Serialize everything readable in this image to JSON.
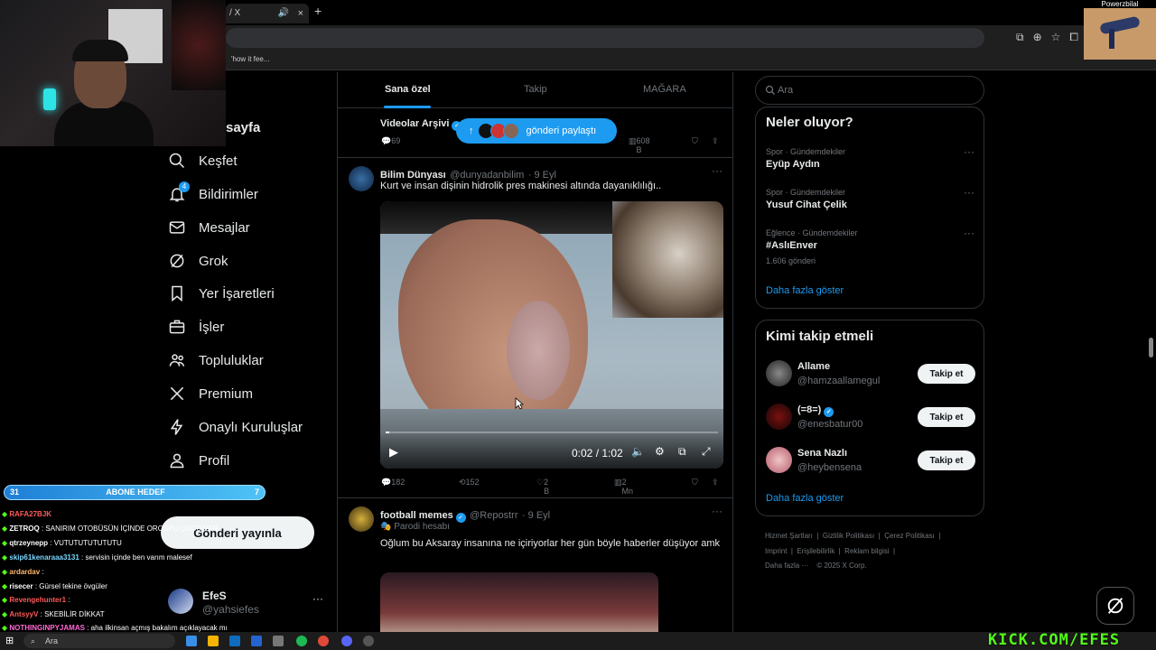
{
  "browser": {
    "tab_title": "/ X",
    "new_tab": "+",
    "tab_close": "×",
    "bookmark": "'how it fee..."
  },
  "stream": {
    "cam2_label": "Powerzbilal",
    "sub_goal": {
      "current": "31",
      "label": "ABONE HEDEF",
      "target": "7"
    },
    "chat": [
      {
        "user": "RAFA27BJK",
        "msg": "",
        "color": "#ff5a5a"
      },
      {
        "user": "ZETROQ",
        "msg": ": SANIRIM OTOBÜSÜN İÇİNDE OROSPU ÇOCU VAR",
        "color": "#ffffff"
      },
      {
        "user": "qtrzeynepp",
        "msg": ": VUTUTUTUTUTUTU",
        "color": "#ffffff"
      },
      {
        "user": "skip61kenaraaa3131",
        "msg": ": servisin içinde ben varım malesef",
        "color": "#7ad7ff"
      },
      {
        "user": "ardardav",
        "msg": ":",
        "color": "#ffb86c"
      },
      {
        "user": "risecer",
        "msg": ": Gürsel tekine övgüler",
        "color": "#ffffff"
      },
      {
        "user": "Revengehunter1",
        "msg": ":",
        "color": "#ff5a5a"
      },
      {
        "user": "AntsyyV",
        "msg": ": SKEBİLİR DİKKAT",
        "color": "#ff5a5a"
      },
      {
        "user": "NOTHINGINPYJAMAS",
        "msg": ": aha ilkinsan açmış bakalım açıklayacak mı",
        "color": "#ff6ad5"
      }
    ],
    "kick": "KICK.COM/EFES"
  },
  "nav": {
    "home_partial": "sayfa",
    "items": [
      {
        "label": "Keşfet",
        "icon": "search-icon"
      },
      {
        "label": "Bildirimler",
        "icon": "bell-icon",
        "badge": "4"
      },
      {
        "label": "Mesajlar",
        "icon": "mail-icon"
      },
      {
        "label": "Grok",
        "icon": "grok-icon"
      },
      {
        "label": "Yer İşaretleri",
        "icon": "bookmark-icon"
      },
      {
        "label": "İşler",
        "icon": "briefcase-icon"
      },
      {
        "label": "Topluluklar",
        "icon": "people-icon"
      },
      {
        "label": "Premium",
        "icon": "x-logo-icon"
      },
      {
        "label": "Onaylı Kuruluşlar",
        "icon": "lightning-icon"
      },
      {
        "label": "Profil",
        "icon": "person-icon"
      }
    ],
    "post_button": "Gönderi yayınla",
    "account": {
      "name": "EfeS",
      "handle": "@yahsiefes",
      "more": "···"
    }
  },
  "feed": {
    "tabs": [
      "Sana özel",
      "Takip",
      "MAĞARA"
    ],
    "share_pill": "gönderi paylaştı",
    "tweet0": {
      "name": "Videolar Arşivi",
      "replies": "69",
      "views": "608 B"
    },
    "tweet1": {
      "name": "Bilim Dünyası",
      "handle": "@dunyadanbilim",
      "date": "· 9 Eyl",
      "text": "Kurt ve insan dişinin hidrolik pres makinesi altında dayanıklılığı..",
      "video_time": "0:02 / 1:02",
      "replies": "182",
      "reposts": "152",
      "likes": "2 B",
      "views": "2 Mn"
    },
    "tweet2": {
      "name": "football memes",
      "handle": "@Repostrr",
      "date": "· 9 Eyl",
      "parody": "Parodi hesabı",
      "text": "Oğlum bu Aksaray insanına ne içiriyorlar her gün böyle haberler düşüyor amk"
    }
  },
  "sidebar": {
    "search_placeholder": "Ara",
    "trends_title": "Neler oluyor?",
    "trends": [
      {
        "category": "Spor · Gündemdekiler",
        "name": "Eyüp Aydın",
        "count": ""
      },
      {
        "category": "Spor · Gündemdekiler",
        "name": "Yusuf Cihat Çelik",
        "count": ""
      },
      {
        "category": "Eğlence · Gündemdekiler",
        "name": "#AslıEnver",
        "count": "1.606 gönderi"
      }
    ],
    "show_more": "Daha fazla göster",
    "who_title": "Kimi takip etmeli",
    "who": [
      {
        "name": "Allame",
        "handle": "@hamzaallamegul",
        "button": "Takip et"
      },
      {
        "name": "(=8=)",
        "handle": "@enesbatur00",
        "button": "Takip et"
      },
      {
        "name": "Sena Nazlı",
        "handle": "@heybensena",
        "button": "Takip et"
      }
    ],
    "footer": [
      "Hizmet Şartları",
      "Gizlilik Politikası",
      "Çerez Politikası",
      "Imprint",
      "Erişilebilirlik",
      "Reklam bilgisi",
      "Daha fazla ···",
      "© 2025 X Corp."
    ]
  },
  "taskbar": {
    "search": "Ara"
  }
}
